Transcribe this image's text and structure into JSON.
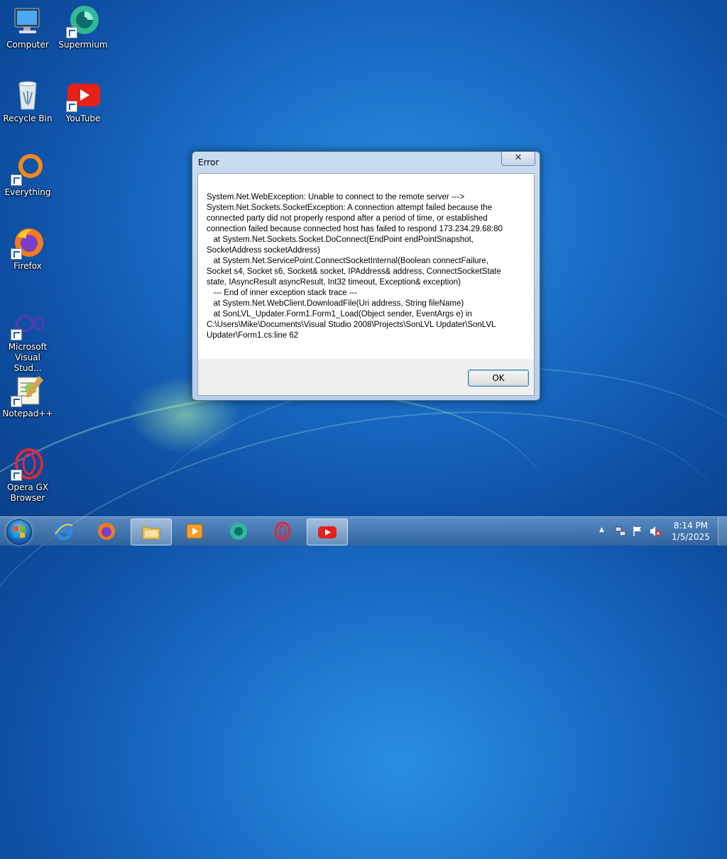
{
  "desktop": {
    "icons": [
      {
        "label": "Computer"
      },
      {
        "label": "Supermium"
      },
      {
        "label": "Recycle Bin"
      },
      {
        "label": "YouTube"
      },
      {
        "label": "Everything"
      },
      {
        "label": "Firefox"
      },
      {
        "label": "Microsoft Visual Stud..."
      },
      {
        "label": "Notepad++"
      },
      {
        "label": "Opera GX Browser"
      }
    ]
  },
  "dialog": {
    "title": "Error",
    "close_label": "✕",
    "message": "System.Net.WebException: Unable to connect to the remote server --->\nSystem.Net.Sockets.SocketException: A connection attempt failed because the\nconnected party did not properly respond after a period of time, or established\nconnection failed because connected host has failed to respond 173.234.29.68:80\n   at System.Net.Sockets.Socket.DoConnect(EndPoint endPointSnapshot,\nSocketAddress socketAddress)\n   at System.Net.ServicePoint.ConnectSocketInternal(Boolean connectFailure,\nSocket s4, Socket s6, Socket& socket, IPAddress& address, ConnectSocketState\nstate, IAsyncResult asyncResult, Int32 timeout, Exception& exception)\n   --- End of inner exception stack trace ---\n   at System.Net.WebClient.DownloadFile(Uri address, String fileName)\n   at SonLVL_Updater.Form1.Form1_Load(Object sender, EventArgs e) in\nC:\\Users\\Mike\\Documents\\Visual Studio 2008\\Projects\\SonLVL Updater\\SonLVL\nUpdater\\Form1.cs:line 62",
    "ok_label": "OK"
  },
  "taskbar": {
    "items": [
      "start",
      "internet-explorer",
      "firefox",
      "file-explorer",
      "media-player",
      "supermium",
      "opera-gx",
      "youtube"
    ],
    "tray": {
      "show_hidden_label": "▲",
      "time": "8:14 PM",
      "date": "1/5/2025"
    }
  },
  "colors": {
    "desktop_bg": "#1a6fc8",
    "taskbar": "#5a8cc0",
    "youtube_red": "#e62117",
    "firefox_orange": "#f47b20",
    "opera_red": "#e0283c"
  }
}
